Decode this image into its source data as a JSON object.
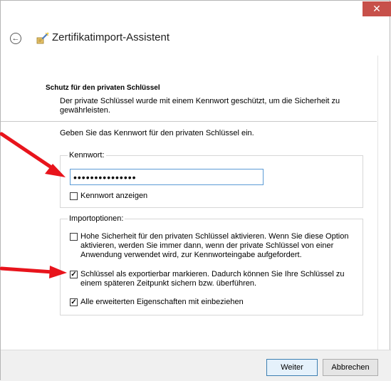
{
  "window": {
    "close_glyph": "✕",
    "back_glyph": "←",
    "title": "Zertifikatimport-Assistent"
  },
  "section": {
    "title": "Schutz für den privaten Schlüssel",
    "description": "Der private Schlüssel wurde mit einem Kennwort geschützt, um die Sicherheit zu gewährleisten."
  },
  "instruction": "Geben Sie das Kennwort für den privaten Schlüssel ein.",
  "password_group": {
    "legend": "Kennwort:",
    "value": "•••••••••••••••",
    "show_password": {
      "label": "Kennwort anzeigen",
      "checked": false
    }
  },
  "import_options": {
    "legend": "Importoptionen:",
    "options": [
      {
        "label": "Hohe Sicherheit für den privaten Schlüssel aktivieren. Wenn Sie diese Option aktivieren, werden Sie immer dann, wenn der private Schlüssel von einer Anwendung verwendet wird, zur Kennworteingabe aufgefordert.",
        "checked": false
      },
      {
        "label": "Schlüssel als exportierbar markieren. Dadurch können Sie Ihre Schlüssel zu einem späteren Zeitpunkt sichern bzw. überführen.",
        "checked": true
      },
      {
        "label": "Alle erweiterten Eigenschaften mit einbeziehen",
        "checked": true
      }
    ]
  },
  "buttons": {
    "next": "Weiter",
    "cancel": "Abbrechen"
  },
  "colors": {
    "close": "#c7504a",
    "annotation_arrow": "#e8141c",
    "focus_border": "#5b9bd5"
  }
}
